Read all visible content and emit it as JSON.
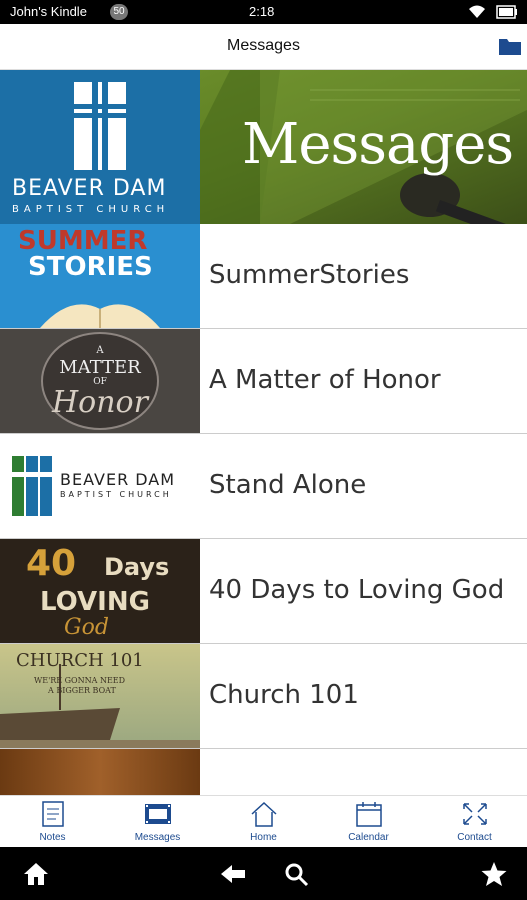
{
  "status_bar": {
    "device_name": "John's Kindle",
    "notification_count": "50",
    "time": "2:18"
  },
  "header": {
    "title": "Messages",
    "folder_icon": "folder-icon"
  },
  "banner": {
    "church_name": "BEAVER DAM",
    "church_sub": "BAPTIST CHURCH",
    "title": "Messages",
    "colors": {
      "left_bg": "#1c6fa6",
      "right_bg": "#5b7c22"
    }
  },
  "messages": [
    {
      "label": "SummerStories",
      "thumb_text": [
        "SUMMER",
        "STORIES"
      ]
    },
    {
      "label": "A Matter of Honor",
      "thumb_text": [
        "A",
        "MATTER",
        "OF",
        "Honor"
      ]
    },
    {
      "label": "Stand Alone",
      "thumb_text": [
        "BEAVER DAM",
        "BAPTIST CHURCH"
      ]
    },
    {
      "label": "40 Days to Loving God",
      "thumb_text": [
        "40",
        "Days",
        "LOVING",
        "God"
      ]
    },
    {
      "label": "Church 101",
      "thumb_text": [
        "CHURCH 101",
        "WE'RE GONNA NEED",
        "A BIGGER BOAT"
      ]
    }
  ],
  "tabs": [
    {
      "label": "Notes",
      "icon": "notes-icon"
    },
    {
      "label": "Messages",
      "icon": "film-icon"
    },
    {
      "label": "Home",
      "icon": "home-icon"
    },
    {
      "label": "Calendar",
      "icon": "calendar-icon"
    },
    {
      "label": "Contact",
      "icon": "contact-icon"
    }
  ],
  "nav": [
    "home-icon",
    "back-icon",
    "search-icon",
    "star-icon"
  ],
  "accent_color": "#1d4b8f"
}
